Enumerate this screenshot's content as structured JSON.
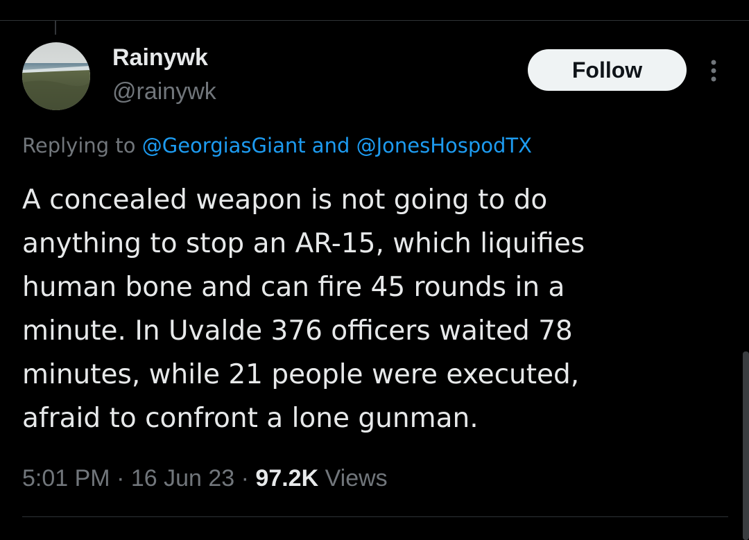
{
  "tweet": {
    "author": {
      "display_name": "Rainywk",
      "handle": "@rainywk",
      "avatar": "beach-landscape-avatar"
    },
    "follow_label": "Follow",
    "more_icon": "more-vertical-icon",
    "reply": {
      "prefix": "Replying to ",
      "mention_1": "@GeorgiasGiant",
      "conjunction": " and ",
      "mention_2": "@JonesHospodTX"
    },
    "text_lines": [
      "A concealed weapon is not going to do",
      "anything to stop an AR-15, which liquifies",
      "human bone and can fire 45 rounds in a",
      "minute. In Uvalde 376 officers waited 78",
      "minutes, while 21 people were executed,",
      "afraid to confront a lone gunman."
    ],
    "meta": {
      "time": "5:01 PM",
      "separator": " · ",
      "date": "16 Jun 23",
      "views_count": "97.2K",
      "views_label": " Views"
    }
  },
  "colors": {
    "background": "#000000",
    "text_primary": "#e7e9ea",
    "text_secondary": "#71767b",
    "link": "#1d9bf0",
    "follow_bg": "#eff3f4",
    "divider": "#2f3336"
  }
}
